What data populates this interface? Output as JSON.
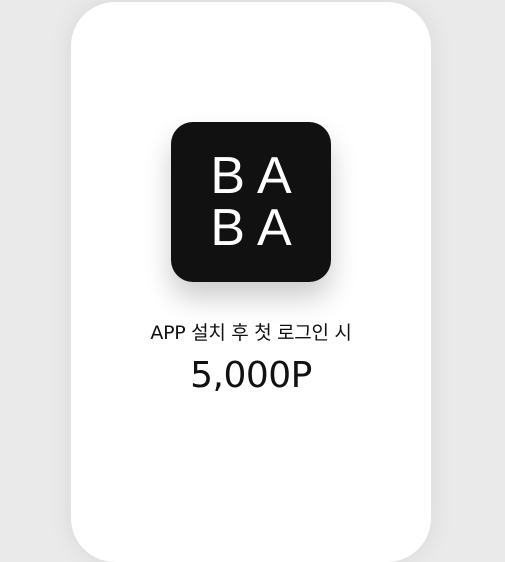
{
  "app": {
    "logo_line_1": "BA",
    "logo_line_2": "BA",
    "icon_background": "#111111",
    "logo_color": "#ffffff"
  },
  "promo": {
    "caption": "APP 설치 후 첫 로그인  시",
    "reward": "5,000P"
  },
  "colors": {
    "page_background": "#eaeaea",
    "card_background": "#ffffff",
    "text": "#111111"
  }
}
